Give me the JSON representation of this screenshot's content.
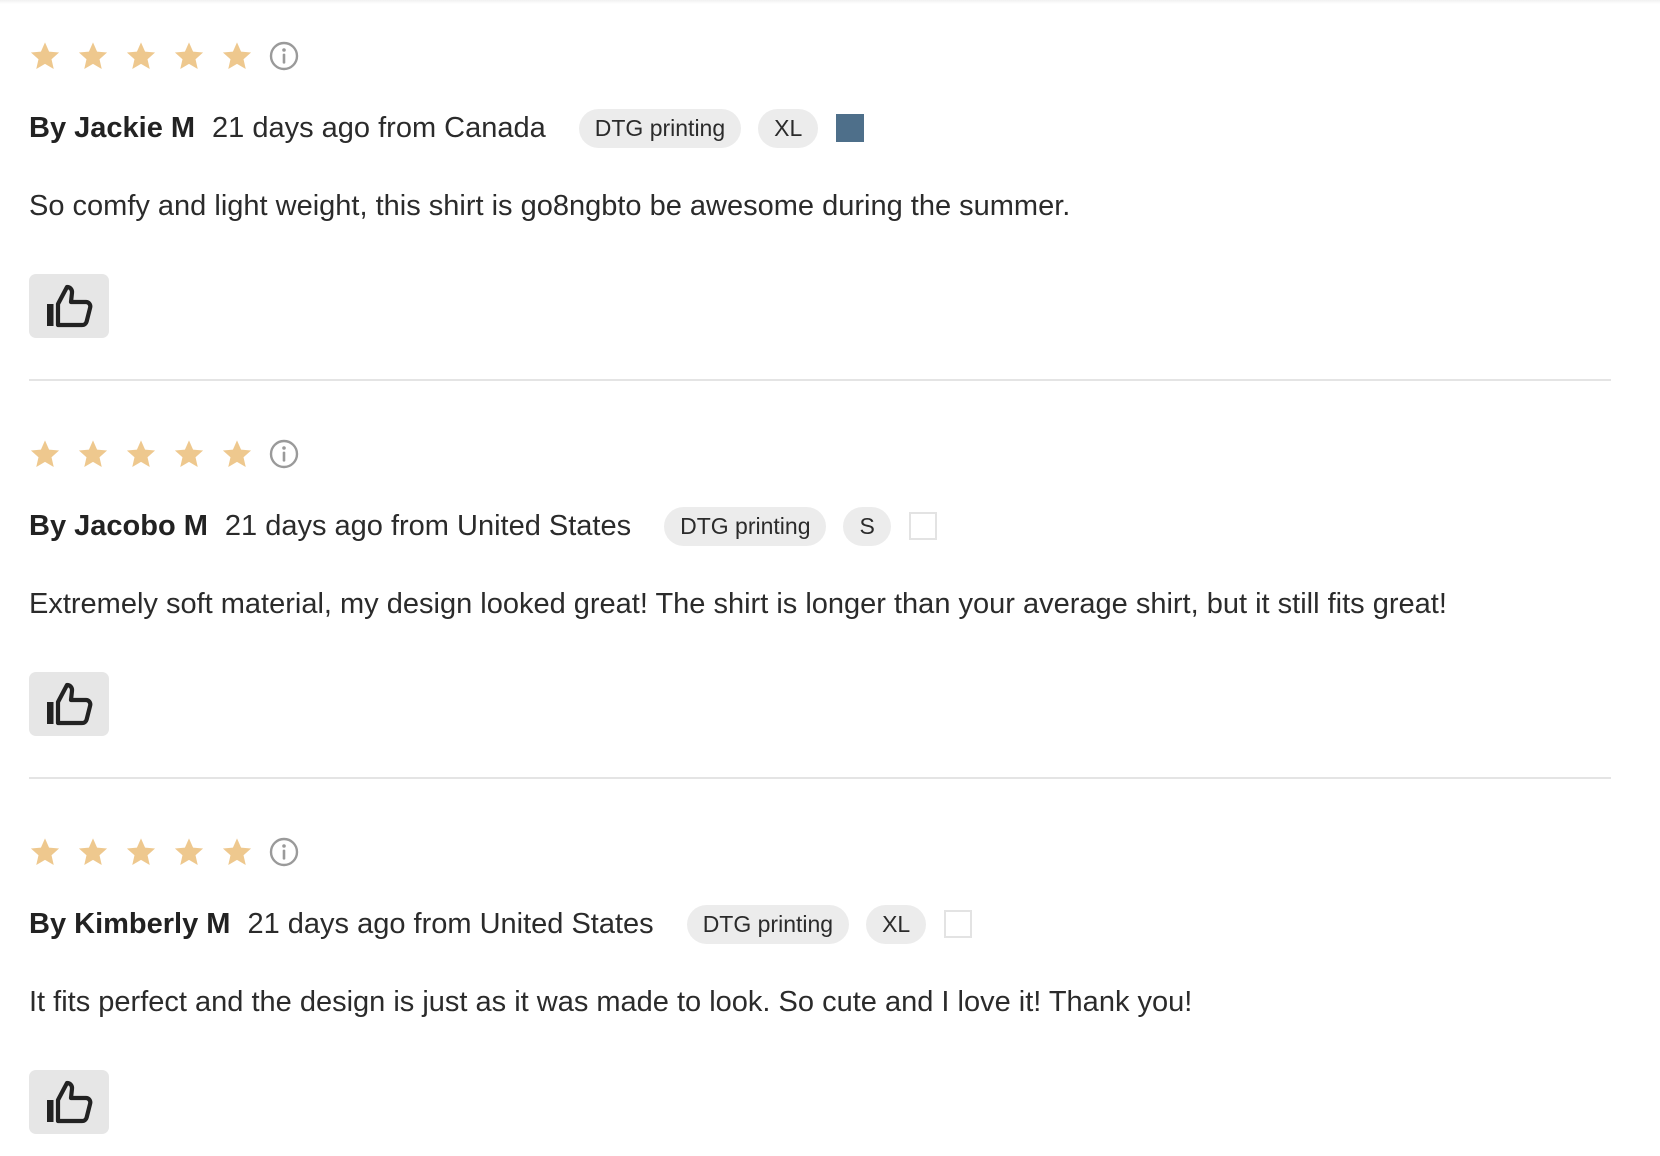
{
  "colors": {
    "star": "#eec88e",
    "info_icon": "#9a9a9a",
    "pill_bg": "#ececec",
    "like_bg": "#e6e6e6",
    "divider": "#e4e4e4"
  },
  "reviews": [
    {
      "rating": 5,
      "author": "By Jackie M",
      "date_location": "21 days ago from Canada",
      "print_method": "DTG printing",
      "size": "XL",
      "color_swatch": "#4e6f8a",
      "text": "So comfy and light weight, this shirt is go8ngbto be awesome during the summer.",
      "like_icon": "thumbs-up-icon"
    },
    {
      "rating": 5,
      "author": "By Jacobo M",
      "date_location": "21 days ago from United States",
      "print_method": "DTG printing",
      "size": "S",
      "color_swatch": "#ffffff",
      "text": "Extremely soft material, my design looked great! The shirt is longer than your average shirt, but it still fits great!",
      "like_icon": "thumbs-up-icon"
    },
    {
      "rating": 5,
      "author": "By Kimberly M",
      "date_location": "21 days ago from United States",
      "print_method": "DTG printing",
      "size": "XL",
      "color_swatch": "#ffffff",
      "text": "It fits perfect and the design is just as it was made to look. So cute and I love it! Thank you!",
      "like_icon": "thumbs-up-icon"
    }
  ]
}
